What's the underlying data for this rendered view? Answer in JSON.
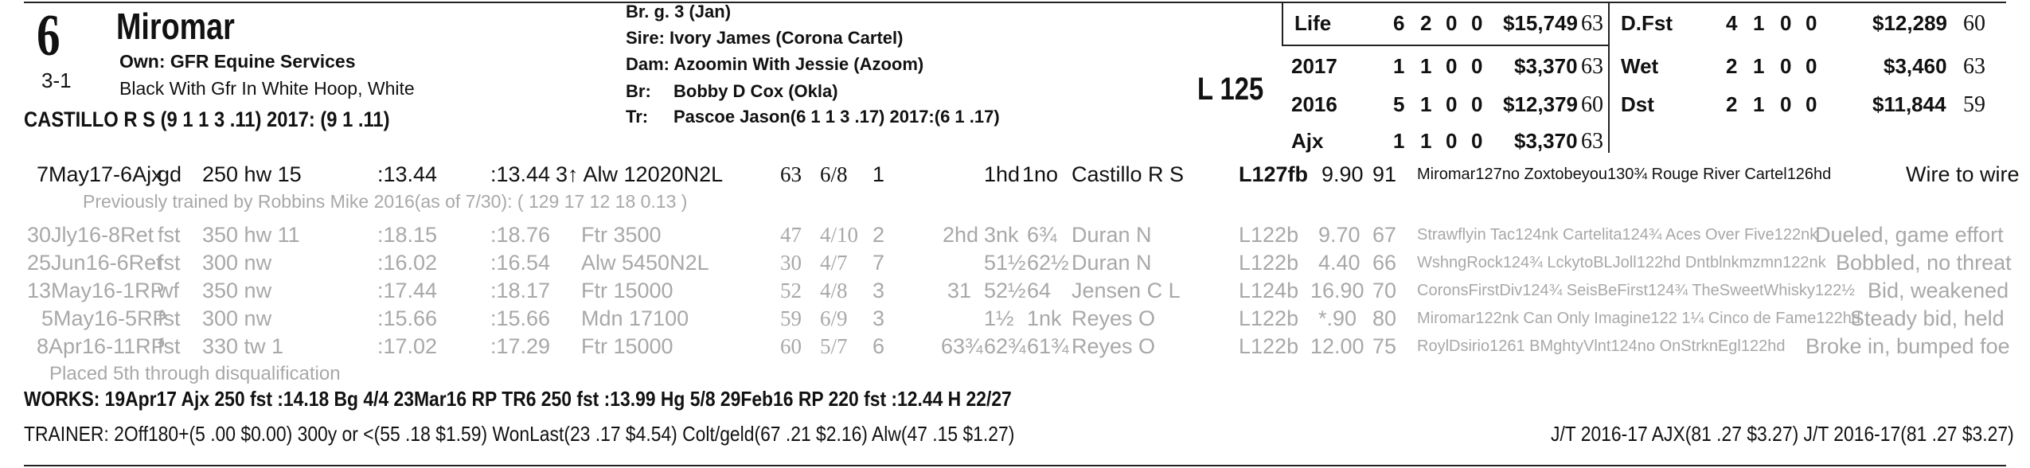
{
  "header": {
    "program_number": "6",
    "horse_name": "Miromar",
    "odds": "3-1",
    "owner": "Own: GFR Equine Services",
    "silks": "Black With Gfr In White Hoop, White",
    "jockey_line": "CASTILLO R S (9 1 1 3 .11) 2017: (9 1 .11)"
  },
  "breeding": {
    "sex_age": "Br. g. 3 (Jan)",
    "sire": "Sire: Ivory James (Corona Cartel)",
    "dam": "Dam: Azoomin With Jessie (Azoom)",
    "breeder_label": "Br:",
    "breeder": "Bobby D Cox (Okla)",
    "trainer_label": "Tr:",
    "trainer": "Pascoe Jason(6 1 1 3 .17) 2017:(6 1 .17)"
  },
  "weight": "L 125",
  "stats_left": [
    {
      "label": "Life",
      "st": "6",
      "w": "2",
      "p": "0",
      "s": "0",
      "earn": "$15,749",
      "sr": "63"
    },
    {
      "label": "2017",
      "st": "1",
      "w": "1",
      "p": "0",
      "s": "0",
      "earn": "$3,370",
      "sr": "63"
    },
    {
      "label": "2016",
      "st": "5",
      "w": "1",
      "p": "0",
      "s": "0",
      "earn": "$12,379",
      "sr": "60"
    },
    {
      "label": "Ajx",
      "st": "1",
      "w": "1",
      "p": "0",
      "s": "0",
      "earn": "$3,370",
      "sr": "63"
    }
  ],
  "stats_right": [
    {
      "label": "D.Fst",
      "st": "4",
      "w": "1",
      "p": "0",
      "s": "0",
      "earn": "$12,289",
      "sr": "60"
    },
    {
      "label": "Wet",
      "st": "2",
      "w": "1",
      "p": "0",
      "s": "0",
      "earn": "$3,460",
      "sr": "63"
    },
    {
      "label": "Dst",
      "st": "2",
      "w": "1",
      "p": "0",
      "s": "0",
      "earn": "$11,844",
      "sr": "59"
    }
  ],
  "races": [
    {
      "date": "7May17-6Ajx",
      "cond": "gd",
      "dist": "250 hw 15",
      "frac1": ":13.44",
      "frac2": ":13.44",
      "race": "3↑ Alw 12020N2L",
      "spd": "63",
      "pp": "6/8",
      "st": "1",
      "c1": "",
      "str": "1hd",
      "fin": "1no",
      "jockey": "Castillo R S",
      "wt": "L127fb",
      "odds": "9.90",
      "sr": "91",
      "top3": "Miromar127no Zoxtobeyou130¾ Rouge River Cartel126hd",
      "comment": "Wire to wire"
    },
    {
      "date": "30Jly16-8Ret",
      "cond": "fst",
      "dist": "350 hw 11",
      "frac1": ":18.15",
      "frac2": ":18.76",
      "race": "Ftr 3500",
      "spd": "47",
      "pp": "4/10",
      "st": "2",
      "c1": "2hd",
      "str": "3nk",
      "fin": "6¾",
      "jockey": "Duran N",
      "wt": "L122b",
      "odds": "9.70",
      "sr": "67",
      "top3": "Strawflyin Tac124nk Cartelita124¾ Aces Over Five122nk",
      "comment": "Dueled, game effort"
    },
    {
      "date": "25Jun16-6Ret",
      "cond": "fst",
      "dist": "300 nw",
      "frac1": ":16.02",
      "frac2": ":16.54",
      "race": "Alw 5450N2L",
      "spd": "30",
      "pp": "4/7",
      "st": "7",
      "c1": "",
      "str": "51½",
      "fin": "62½",
      "jockey": "Duran N",
      "wt": "L122b",
      "odds": "4.40",
      "sr": "66",
      "top3": "WshngRock124¾ LckytoBLJoll122hd Dntblnkmzmn122nk",
      "comment": "Bobbled, no threat"
    },
    {
      "date": "13May16-1RP",
      "cond": "wf",
      "dist": "350 nw",
      "frac1": ":17.44",
      "frac2": ":18.17",
      "race": "Ftr 15000",
      "spd": "52",
      "pp": "4/8",
      "st": "3",
      "c1": "31",
      "str": "52½",
      "fin": "64",
      "jockey": "Jensen C L",
      "wt": "L124b",
      "odds": "16.90",
      "sr": "70",
      "top3": "CoronsFirstDiv124¾ SeisBeFirst124¾ TheSweetWhisky122½",
      "comment": "Bid, weakened"
    },
    {
      "date": "5May16-5RP",
      "cond": "fst",
      "dist": "300 nw",
      "frac1": ":15.66",
      "frac2": ":15.66",
      "race": "Mdn 17100",
      "spd": "59",
      "pp": "6/9",
      "st": "3",
      "c1": "",
      "str": "1½",
      "fin": "1nk",
      "jockey": "Reyes O",
      "wt": "L122b",
      "odds": "*.90",
      "sr": "80",
      "top3": "Miromar122nk Can Only Imagine122 1¼ Cinco de Fame122hd",
      "comment": "Steady bid, held"
    },
    {
      "date": "8Apr16-11RP",
      "cond": "fst",
      "dist": "330 tw 1",
      "frac1": ":17.02",
      "frac2": ":17.29",
      "race": "Ftr 15000",
      "spd": "60",
      "pp": "5/7",
      "st": "6",
      "c1": "63¾",
      "str": "62¾",
      "fin": "61¾",
      "jockey": "Reyes O",
      "wt": "L122b",
      "odds": "12.00",
      "sr": "75",
      "top3": "RoylDsirio1261 BMghtyVlnt124no OnStrknEgl122hd",
      "comment": "Broke in, bumped foe"
    }
  ],
  "notes": {
    "prev_trained": "Previously trained by Robbins Mike 2016(as of 7/30): ( 129 17 12 18 0.13 )",
    "placed": "Placed 5th through disqualification"
  },
  "works": "WORKS:   19Apr17 Ajx 250 fst :14.18 Bg 4/4   23Mar16 RP TR6 250 fst :13.99 Hg 5/8   29Feb16 RP 220 fst :12.44 H 22/27",
  "trainer_stats": "TRAINER: 2Off180+(5 .00 $0.00) 300y or <(55 .18 $1.59) WonLast(23 .17 $4.54) Colt/geld(67 .21 $2.16) Alw(47 .15 $1.27)",
  "jt_stats": "J/T 2016-17 AJX(81 .27 $3.27)  J/T 2016-17(81 .27 $3.27)"
}
